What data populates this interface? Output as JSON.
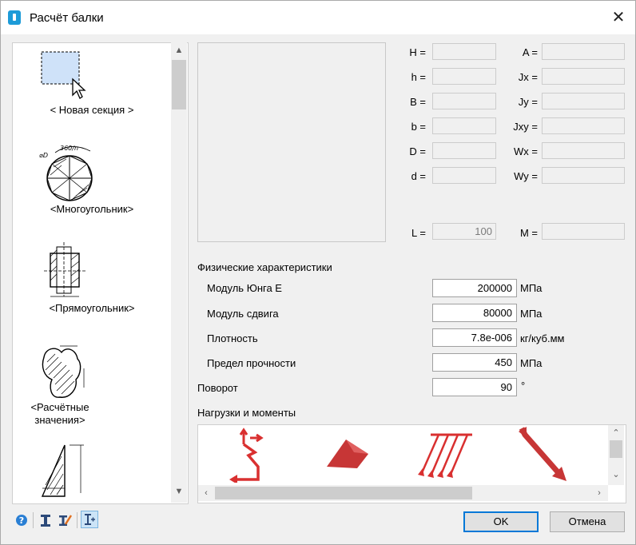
{
  "window": {
    "title": "Расчёт балки",
    "close_glyph": "✕"
  },
  "sections_list": [
    {
      "label": "< Новая секция >",
      "icon": "new-section-icon"
    },
    {
      "label": "<Многоугольник>",
      "icon": "polygon-section-icon"
    },
    {
      "label": "<Прямоугольник>",
      "icon": "rectangle-section-icon"
    },
    {
      "label": "<Расчётные значения>",
      "icon": "calculated-section-icon"
    },
    {
      "label": "",
      "icon": "triangle-section-icon"
    }
  ],
  "params_left": [
    {
      "label": "H =",
      "value": ""
    },
    {
      "label": "h =",
      "value": ""
    },
    {
      "label": "B =",
      "value": ""
    },
    {
      "label": "b =",
      "value": ""
    },
    {
      "label": "D =",
      "value": ""
    },
    {
      "label": "d =",
      "value": ""
    }
  ],
  "params_right": [
    {
      "label": "A =",
      "value": ""
    },
    {
      "label": "Jx =",
      "value": ""
    },
    {
      "label": "Jy =",
      "value": ""
    },
    {
      "label": "Jxy =",
      "value": ""
    },
    {
      "label": "Wx =",
      "value": ""
    },
    {
      "label": "Wy =",
      "value": ""
    }
  ],
  "length": {
    "label": "L =",
    "value": "100"
  },
  "moment": {
    "label": "M =",
    "value": ""
  },
  "physical": {
    "heading": "Физические характеристики",
    "rows": [
      {
        "label": "Модуль Юнга Е",
        "value": "200000",
        "unit": "МПа"
      },
      {
        "label": "Модуль сдвига",
        "value": "80000",
        "unit": "МПа"
      },
      {
        "label": "Плотность",
        "value": "7.8e-006",
        "unit": "кг/куб.мм"
      },
      {
        "label": "Предел прочности",
        "value": "450",
        "unit": "МПа"
      }
    ]
  },
  "rotation": {
    "label": "Поворот",
    "value": "90",
    "unit": "°"
  },
  "loads": {
    "heading": "Нагрузки и моменты",
    "icons": [
      "concentrated-load-icon",
      "surface-load-icon",
      "distributed-load-icon",
      "axial-force-icon"
    ],
    "accent": "#d93030"
  },
  "buttons": {
    "ok": "OK",
    "cancel": "Отмена"
  },
  "toolbar": [
    "help-icon",
    "beam-section-icon",
    "beam-edit-icon",
    "insert-section-icon"
  ]
}
